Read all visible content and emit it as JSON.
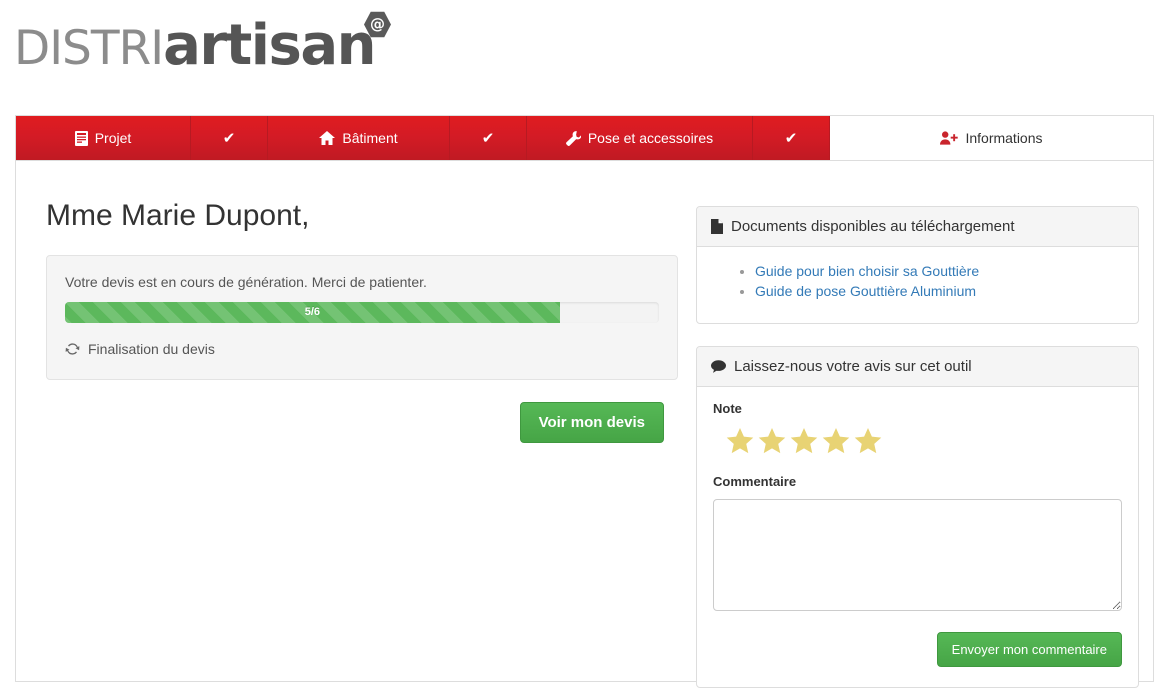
{
  "brand": {
    "name_light": "DISTRI",
    "name_bold": "artisan",
    "badge": "@",
    "logo_gray": "#8c8c8c",
    "logo_dark": "#555555"
  },
  "colors": {
    "nav_red": "#d41b25",
    "link_blue": "#337ab7",
    "success_green": "#5cb85c",
    "star_gold": "#e8d374",
    "panel_gray": "#f5f5f5",
    "border_gray": "#dddddd"
  },
  "nav": {
    "tabs": [
      {
        "label": "Projet",
        "icon": "file-lines-icon",
        "active": false,
        "completed": true,
        "check": "✔"
      },
      {
        "label": "Bâtiment",
        "icon": "home-icon",
        "active": false,
        "completed": true,
        "check": "✔"
      },
      {
        "label": "Pose et accessoires",
        "icon": "wrench-icon",
        "active": false,
        "completed": true,
        "check": "✔"
      },
      {
        "label": "Informations",
        "icon": "user-plus-icon",
        "active": true,
        "completed": false,
        "check": ""
      }
    ]
  },
  "main": {
    "greeting": "Mme Marie Dupont,",
    "alert": {
      "message": "Votre devis est en cours de génération. Merci de patienter.",
      "progress_label": "5/6",
      "progress_current": 5,
      "progress_total": 6,
      "progress_percent": 83.3,
      "status_text": "Finalisation du devis",
      "status_icon": "refresh-icon"
    },
    "primary_button": "Voir mon devis"
  },
  "documents_panel": {
    "heading": "Documents disponibles au téléchargement",
    "heading_icon": "file-icon",
    "links": [
      "Guide pour bien choisir sa Gouttière",
      "Guide de pose Gouttière Aluminium"
    ]
  },
  "feedback_panel": {
    "heading": "Laissez-nous votre avis sur cet outil",
    "heading_icon": "comment-icon",
    "rating_label": "Note",
    "rating_value": 5,
    "rating_max": 5,
    "comment_label": "Commentaire",
    "comment_value": "",
    "comment_placeholder": "",
    "submit_label": "Envoyer mon commentaire"
  }
}
